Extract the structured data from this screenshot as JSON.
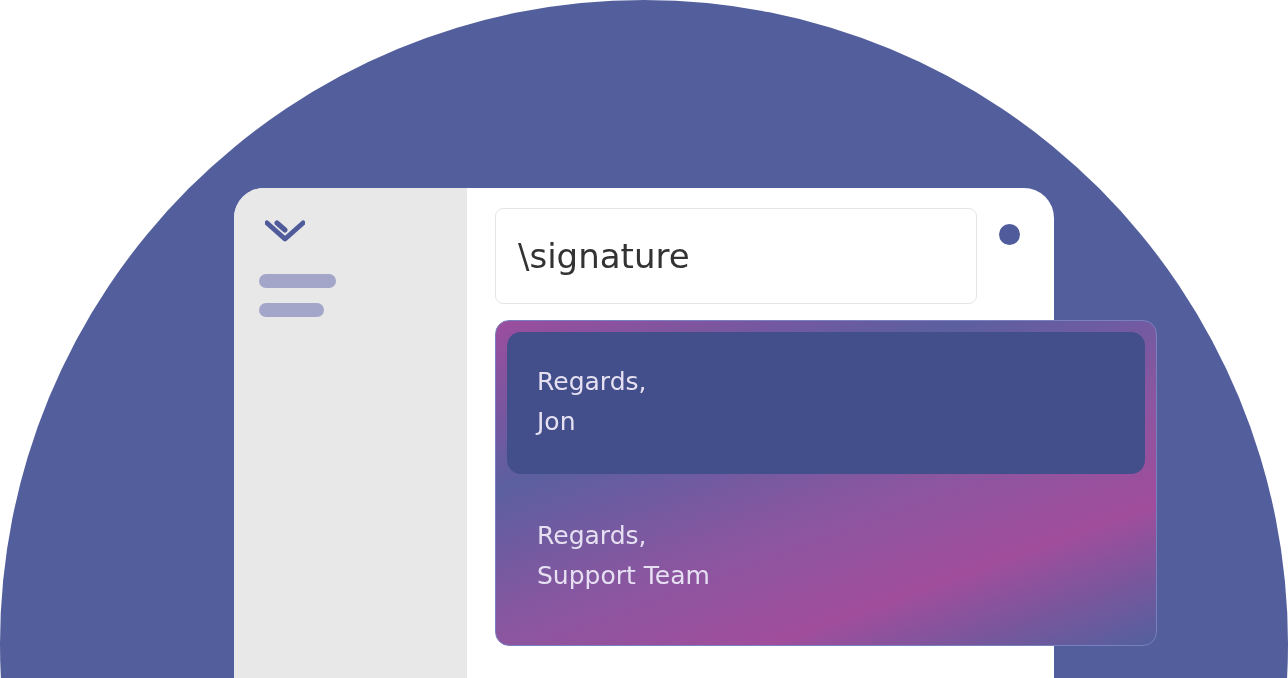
{
  "search": {
    "value": "\\signature"
  },
  "suggestions": [
    {
      "text": "Regards,\nJon",
      "selected": true
    },
    {
      "text": "Regards,\nSupport Team",
      "selected": false
    }
  ]
}
